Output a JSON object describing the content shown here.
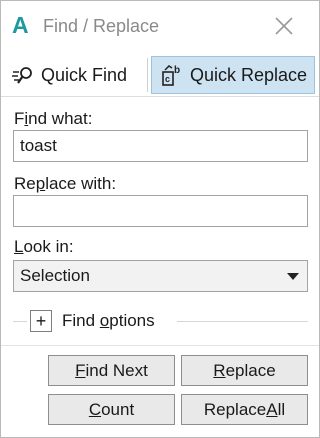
{
  "window": {
    "title": "Find / Replace",
    "app_icon_glyph": "A",
    "accent_color": "#1f9aa0"
  },
  "tabs": [
    {
      "label": "Quick Find",
      "icon": "quick-find-icon",
      "selected": false
    },
    {
      "label": "Quick Replace",
      "icon": "quick-replace-icon",
      "selected": true
    }
  ],
  "find": {
    "label_pre": "F",
    "label_ul": "i",
    "label_post": "nd what:",
    "value": "toast"
  },
  "replace": {
    "label_pre": "Re",
    "label_ul": "p",
    "label_post": "lace with:",
    "value": ""
  },
  "look_in": {
    "label_pre": "",
    "label_ul": "L",
    "label_post": "ook in:",
    "selected": "Selection"
  },
  "find_options": {
    "toggle": "+",
    "label_pre": "Find ",
    "label_ul": "o",
    "label_post": "ptions"
  },
  "buttons": {
    "find_next": {
      "pre": "",
      "ul": "F",
      "post": "ind Next"
    },
    "replace": {
      "pre": "",
      "ul": "R",
      "post": "eplace"
    },
    "count": {
      "pre": "",
      "ul": "C",
      "post": "ount"
    },
    "replace_all": {
      "pre": "Replace ",
      "ul": "A",
      "post": "ll"
    }
  },
  "colors": {
    "selected_tab_bg": "#cde3f2",
    "selected_tab_border": "#9cc4e2",
    "button_bg": "#e9e9e9"
  }
}
